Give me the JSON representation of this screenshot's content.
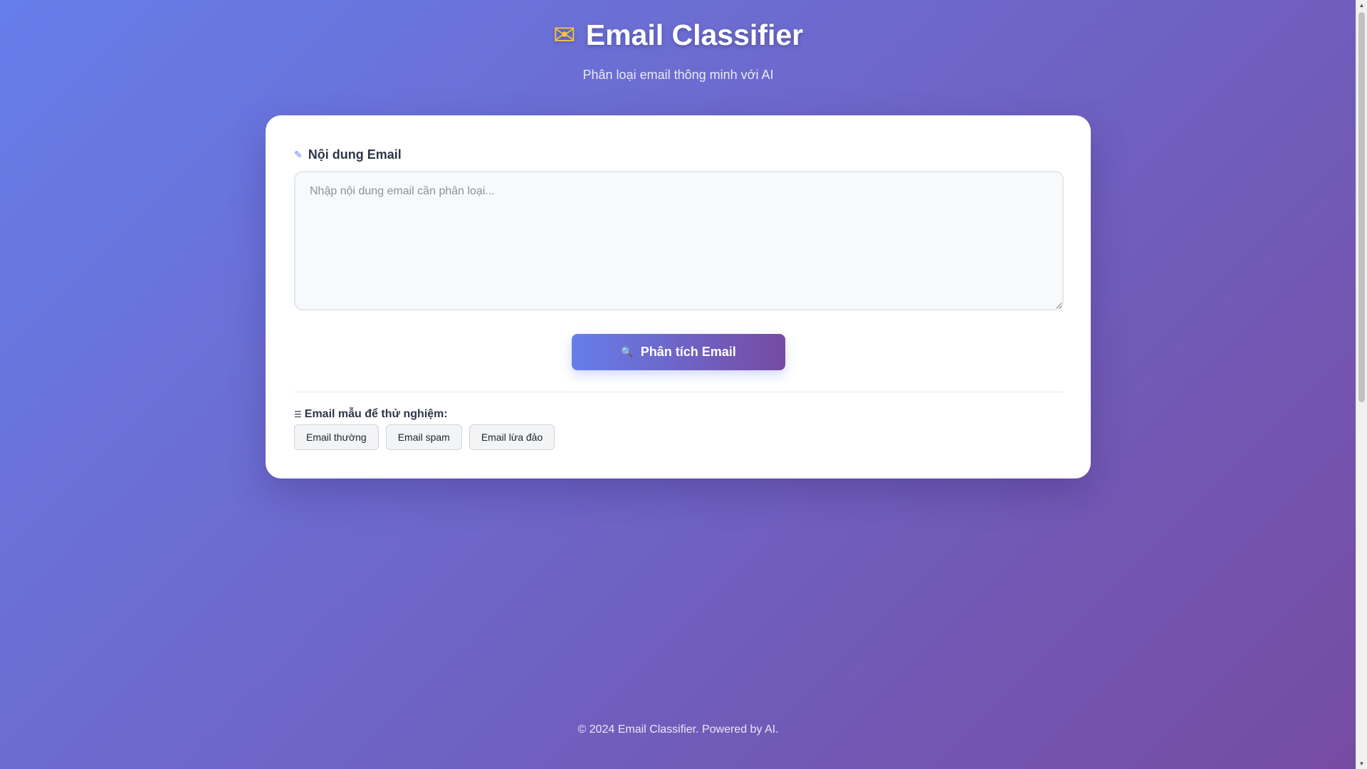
{
  "header": {
    "icon": "envelope-icon",
    "title": "Email Classifier",
    "subtitle": "Phân loại email thông minh với AI"
  },
  "form": {
    "label_icon": "edit-icon",
    "label": "Nội dung Email",
    "textarea_placeholder": "Nhập nội dung email cần phân loại...",
    "textarea_value": "",
    "analyze_icon": "search-icon",
    "analyze_label": "Phân tích Email"
  },
  "samples": {
    "icon": "list-icon",
    "title": "Email mẫu để thử nghiệm:",
    "items": [
      {
        "label": "Email thường"
      },
      {
        "label": "Email spam"
      },
      {
        "label": "Email lừa đảo"
      }
    ]
  },
  "footer": {
    "text": "© 2024 Email Classifier. Powered by AI."
  },
  "colors": {
    "gradient_start": "#667eea",
    "gradient_end": "#764ba2",
    "title_icon": "#f6c245",
    "card_bg": "#ffffff"
  }
}
